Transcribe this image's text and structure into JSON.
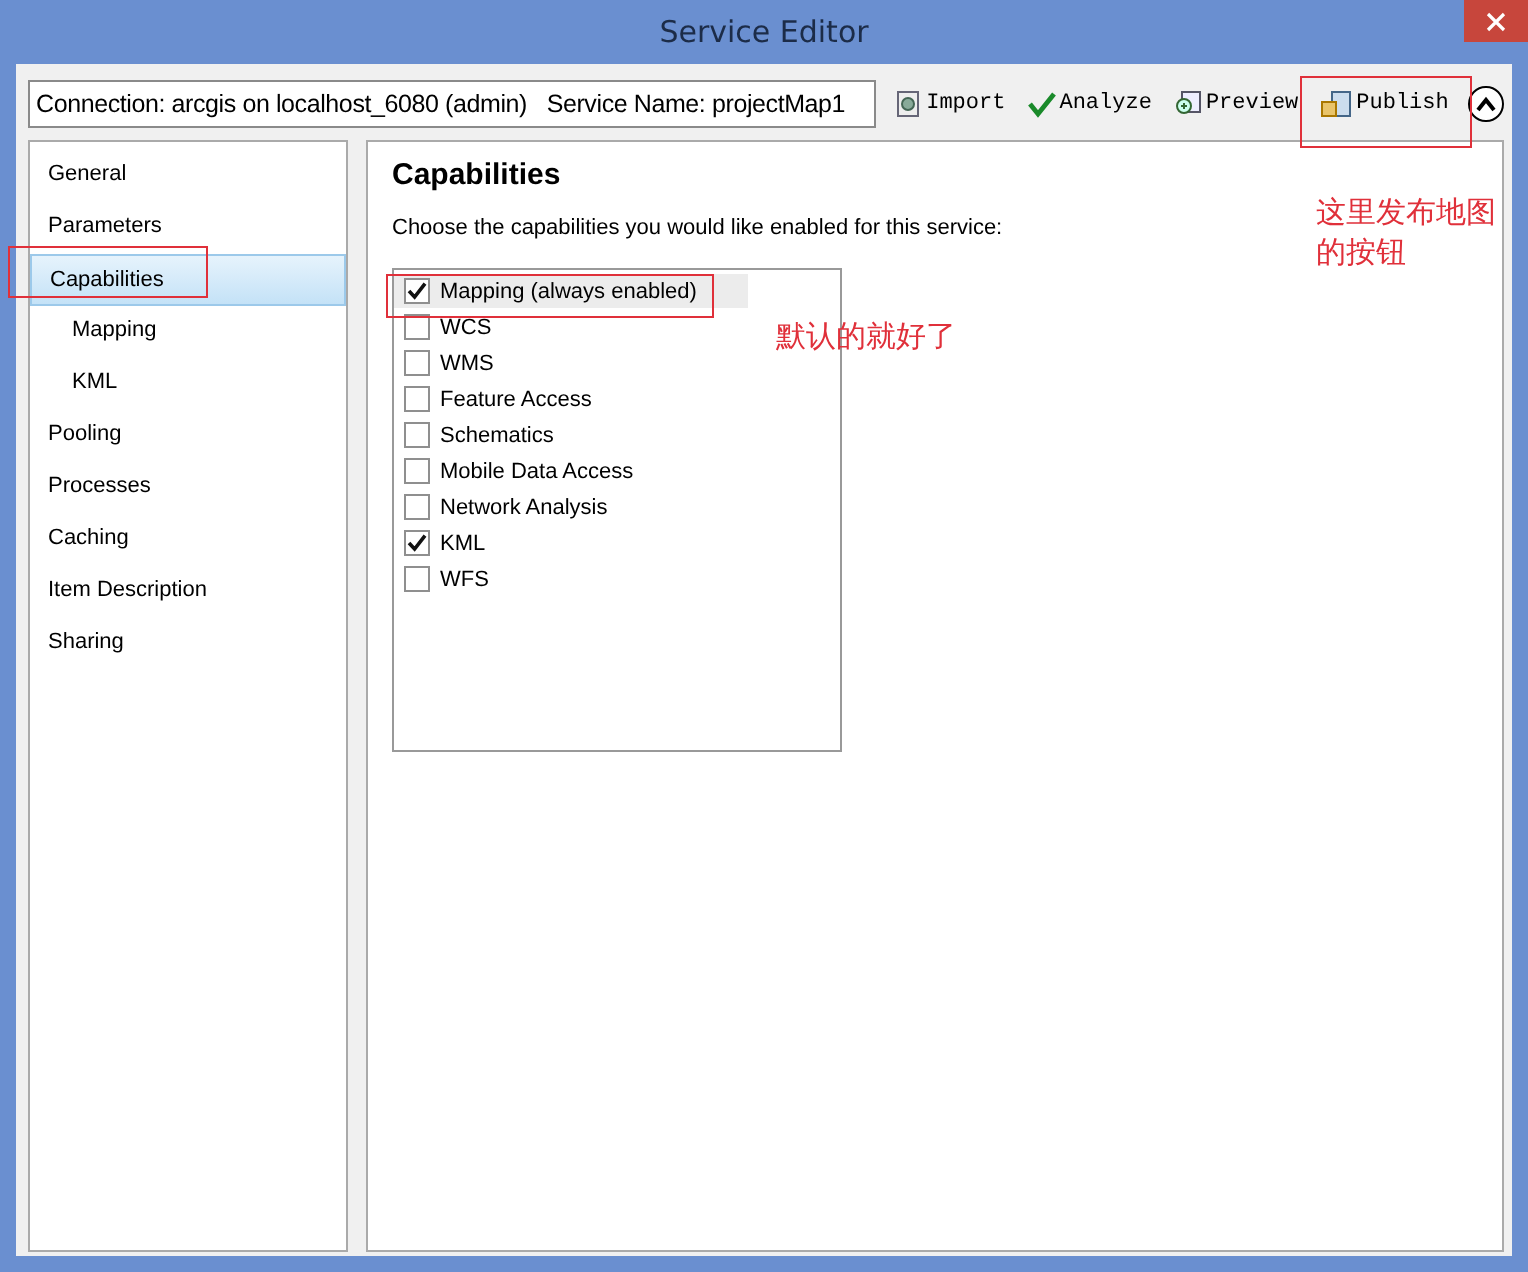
{
  "window": {
    "title": "Service Editor"
  },
  "toolbar": {
    "connection": "Connection: arcgis on localhost_6080 (admin)   Service Name: projectMap1",
    "buttons": [
      {
        "kind": "import",
        "label": "Import"
      },
      {
        "kind": "analyze",
        "label": "Analyze"
      },
      {
        "kind": "preview",
        "label": "Preview"
      },
      {
        "kind": "publish",
        "label": "Publish"
      }
    ],
    "collapse": {
      "expanded": true
    }
  },
  "sidebar": {
    "items": [
      {
        "label": "General",
        "selected": false
      },
      {
        "label": "Parameters",
        "selected": false
      },
      {
        "label": "Capabilities",
        "selected": true,
        "children": [
          {
            "label": "Mapping",
            "selected": false
          },
          {
            "label": "KML",
            "selected": false
          }
        ]
      },
      {
        "label": "Pooling",
        "selected": false
      },
      {
        "label": "Processes",
        "selected": false
      },
      {
        "label": "Caching",
        "selected": false
      },
      {
        "label": "Item Description",
        "selected": false
      },
      {
        "label": "Sharing",
        "selected": false
      }
    ]
  },
  "panel": {
    "heading": "Capabilities",
    "instruction": "Choose the capabilities you would like enabled for this service:",
    "capabilities": [
      {
        "label": "Mapping (always enabled)",
        "checked": true,
        "selected": true
      },
      {
        "label": "WCS",
        "checked": false,
        "selected": false
      },
      {
        "label": "WMS",
        "checked": false,
        "selected": false
      },
      {
        "label": "Feature Access",
        "checked": false,
        "selected": false
      },
      {
        "label": "Schematics",
        "checked": false,
        "selected": false
      },
      {
        "label": "Mobile Data Access",
        "checked": false,
        "selected": false
      },
      {
        "label": "Network Analysis",
        "checked": false,
        "selected": false
      },
      {
        "label": "KML",
        "checked": true,
        "selected": false
      },
      {
        "label": "WFS",
        "checked": false,
        "selected": false
      }
    ]
  },
  "annotations": [
    {
      "kind": "note",
      "text": "默认的就好了"
    },
    {
      "kind": "note",
      "text": "这里发布地图的按钮"
    }
  ]
}
